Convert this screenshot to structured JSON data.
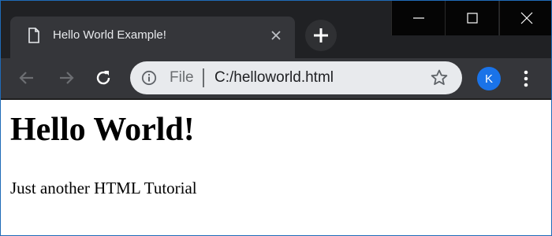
{
  "tab": {
    "title": "Hello World Example!",
    "close_icon": "close-icon",
    "doc_icon": "document-icon"
  },
  "new_tab": {
    "icon": "plus-icon"
  },
  "window_controls": [
    "minimize-icon",
    "maximize-icon",
    "close-icon"
  ],
  "toolbar": {
    "back_icon": "arrow-left-icon",
    "forward_icon": "arrow-right-icon",
    "reload_icon": "reload-icon",
    "omnibox": {
      "info_icon": "info-icon",
      "scheme": "File",
      "url": "C:/helloworld.html",
      "bookmark_icon": "star-icon"
    },
    "profile_initial": "K",
    "menu_icon": "more-vertical-icon"
  },
  "page": {
    "heading": "Hello World!",
    "paragraph": "Just another HTML Tutorial"
  },
  "colors": {
    "tabstrip_bg": "#202124",
    "active_tab_bg": "#35363a",
    "omnibox_bg": "#e8eaed",
    "profile_avatar": "#1a73e8",
    "window_border": "#1f6bb8"
  }
}
